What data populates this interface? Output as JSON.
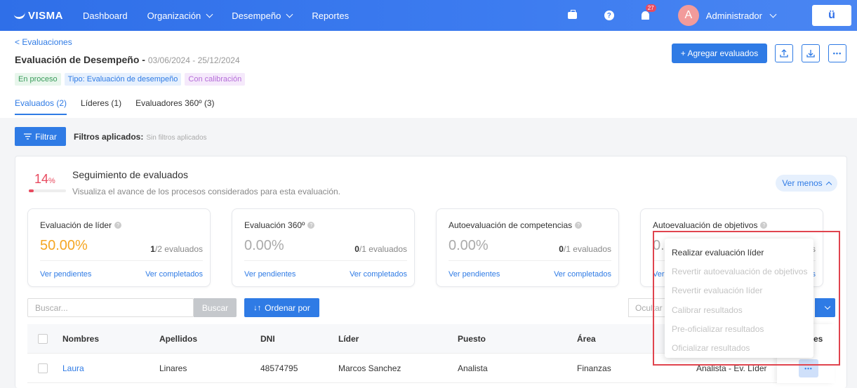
{
  "topbar": {
    "logo": "VISMA",
    "nav": [
      {
        "label": "Dashboard",
        "dropdown": false
      },
      {
        "label": "Organización",
        "dropdown": true
      },
      {
        "label": "Desempeño",
        "dropdown": true
      },
      {
        "label": "Reportes",
        "dropdown": false
      }
    ],
    "help_glyph": "?",
    "notifications_count": "27",
    "avatar_initial": "A",
    "user_name": "Administrador",
    "app_button": "ü"
  },
  "header": {
    "back_link": "< Evaluaciones",
    "title": "Evaluación de Desempeño - ",
    "dates": "03/06/2024 - 25/12/2024",
    "tags": [
      "En proceso",
      "Tipo: Evaluación de desempeño",
      "Con calibración"
    ],
    "add_button": "+ Agregar evaluados",
    "more_glyph": "•••",
    "tabs": [
      {
        "label": "Evaluados (2)",
        "active": true
      },
      {
        "label": "Líderes (1)",
        "active": false
      },
      {
        "label": "Evaluadores 360º (3)",
        "active": false
      }
    ]
  },
  "filters": {
    "button": "Filtrar",
    "applied_label": "Filtros aplicados:",
    "applied_value": "Sin filtros aplicados"
  },
  "tracking": {
    "percent": "14",
    "percent_unit": "%",
    "progress_fraction": 0.14,
    "title": "Seguimiento de evaluados",
    "subtitle": "Visualiza el avance de los procesos considerados para esta evaluación.",
    "toggle": "Ver menos"
  },
  "stats": [
    {
      "label": "Evaluación de líder",
      "value": "50.00%",
      "done": "1",
      "total": "/2 evaluados",
      "pending_link": "Ver pendientes",
      "completed_link": "Ver completados",
      "highlight": true
    },
    {
      "label": "Evaluación 360º",
      "value": "0.00%",
      "done": "0",
      "total": "/1 evaluados",
      "pending_link": "Ver pendientes",
      "completed_link": "Ver completados",
      "highlight": false
    },
    {
      "label": "Autoevaluación de competencias",
      "value": "0.00%",
      "done": "0",
      "total": "/1 evaluados",
      "pending_link": "Ver pendientes",
      "completed_link": "Ver completados",
      "highlight": false
    },
    {
      "label": "Autoevaluación de objetivos",
      "value": "0.",
      "count_partial": "os",
      "pending_partial": "Ver",
      "completed_partial": "dos",
      "highlight": false
    }
  ],
  "toolbar": {
    "search_placeholder": "Buscar...",
    "search_button": "Buscar",
    "order_button": "Ordenar por",
    "hide_columns_partial": "Ocultar c"
  },
  "table": {
    "headers": [
      "Nombres",
      "Apellidos",
      "DNI",
      "Líder",
      "Puesto",
      "Área",
      "es"
    ],
    "rows": [
      {
        "nombres": "Laura",
        "apellidos": "Linares",
        "dni": "48574795",
        "lider": "Marcos Sanchez",
        "puesto": "Analista",
        "area": "Finanzas",
        "estado": "Analista - Ev. Líder",
        "actions_glyph": "•••"
      }
    ]
  },
  "action_menu": {
    "items": [
      {
        "label": "Realizar evaluación líder",
        "enabled": true
      },
      {
        "label": "Revertir autoevaluación de objetivos",
        "enabled": false
      },
      {
        "label": "Revertir evaluación líder",
        "enabled": false
      },
      {
        "label": "Calibrar resultados",
        "enabled": false
      },
      {
        "label": "Pre-oficializar resultados",
        "enabled": false
      },
      {
        "label": "Oficializar resultados",
        "enabled": false
      }
    ]
  },
  "colors": {
    "primary": "#2f7be5",
    "danger": "#e84a5f",
    "warning": "#f5a623",
    "highlight_border": "#e0444e"
  }
}
